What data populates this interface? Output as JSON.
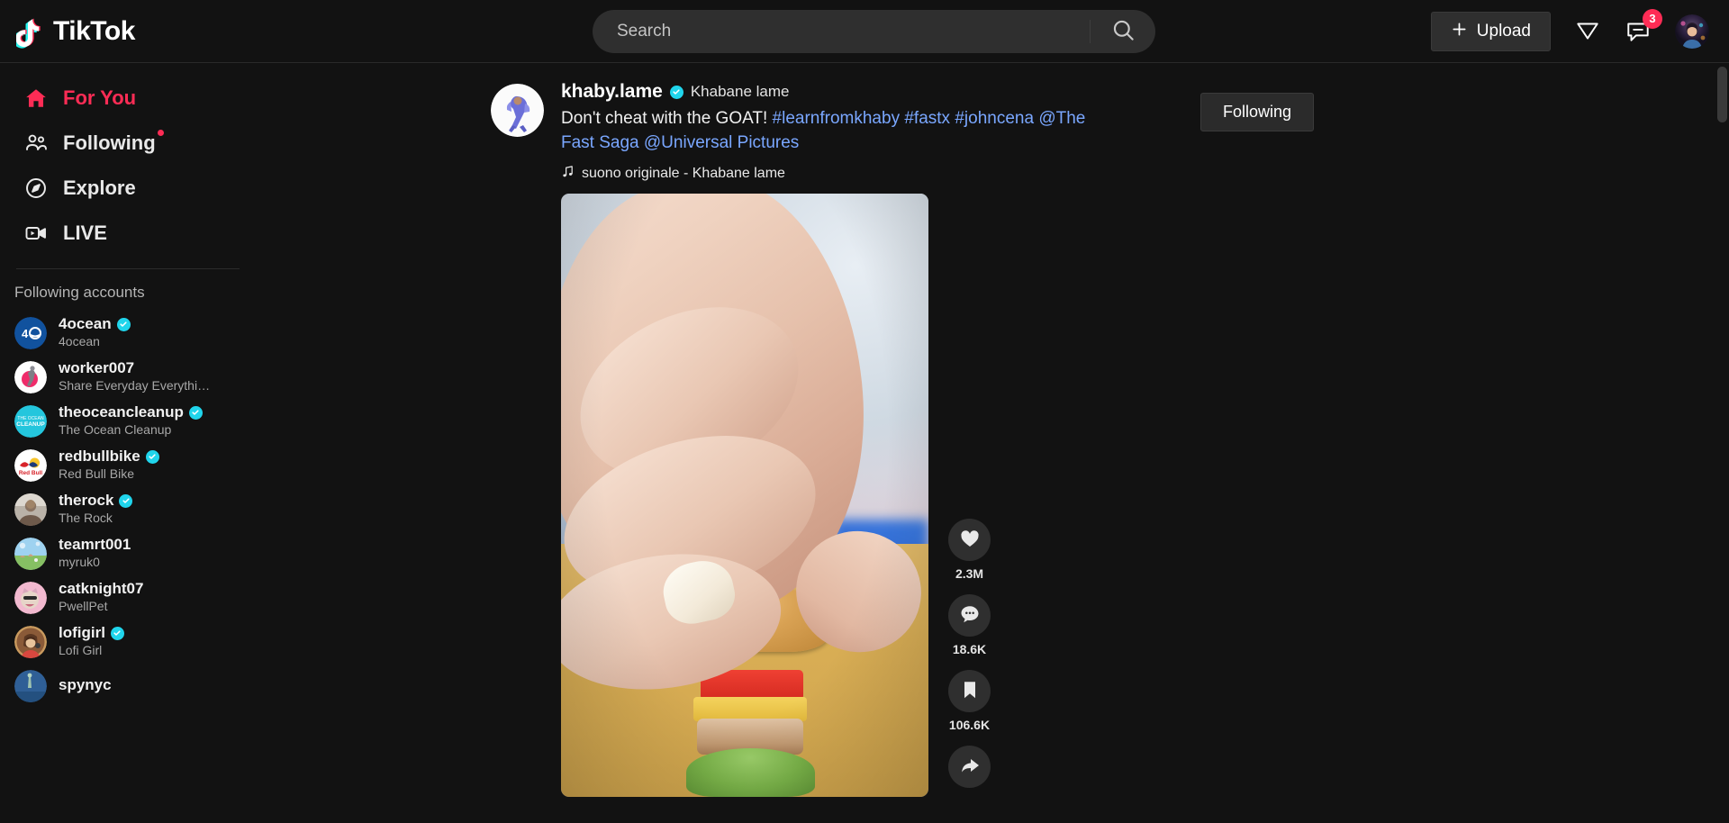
{
  "header": {
    "logo_text": "TikTok",
    "logo_icon": "tiktok-note-icon",
    "search": {
      "placeholder": "Search",
      "value": "",
      "icon": "search-icon"
    },
    "upload_label": "Upload",
    "upload_icon": "plus-icon",
    "send_icon": "paper-plane-icon",
    "messages_icon": "message-icon",
    "messages_badge": "3",
    "profile_icon": "user-avatar"
  },
  "sidebar": {
    "nav": [
      {
        "label": "For You",
        "icon": "home-icon",
        "active": true,
        "dot": false
      },
      {
        "label": "Following",
        "icon": "people-icon",
        "active": false,
        "dot": true
      },
      {
        "label": "Explore",
        "icon": "compass-icon",
        "active": false,
        "dot": false
      },
      {
        "label": "LIVE",
        "icon": "live-video-icon",
        "active": false,
        "dot": false
      }
    ],
    "section_title": "Following accounts",
    "accounts": [
      {
        "name": "4ocean",
        "sub": "4ocean",
        "verified": true,
        "avatar": "4ocean-logo"
      },
      {
        "name": "worker007",
        "sub": "Share Everyday Everythi…",
        "verified": false,
        "avatar": "worker007-logo"
      },
      {
        "name": "theoceancleanup",
        "sub": "The Ocean Cleanup",
        "verified": true,
        "avatar": "oceancleanup-logo"
      },
      {
        "name": "redbullbike",
        "sub": "Red Bull Bike",
        "verified": true,
        "avatar": "redbull-logo"
      },
      {
        "name": "therock",
        "sub": "The Rock",
        "verified": true,
        "avatar": "therock-photo"
      },
      {
        "name": "teamrt001",
        "sub": "myruk0",
        "verified": false,
        "avatar": "teamrt001-photo"
      },
      {
        "name": "catknight07",
        "sub": "PwellPet",
        "verified": false,
        "avatar": "catknight07-photo"
      },
      {
        "name": "lofigirl",
        "sub": "Lofi Girl",
        "verified": true,
        "avatar": "lofigirl-art"
      },
      {
        "name": "spynyc",
        "sub": "",
        "verified": false,
        "avatar": "spynyc-photo"
      }
    ]
  },
  "post": {
    "username": "khaby.lame",
    "verified": true,
    "nickname": "Khabane lame",
    "caption_text": "Don't cheat with the GOAT! ",
    "caption_tags": [
      "#learnfromkhaby",
      "#fastx",
      "#johncena",
      "@The Fast Saga",
      "@Universal Pictures"
    ],
    "music_icon": "music-note-icon",
    "music_label": "suono originale - Khabane lame",
    "follow_label": "Following",
    "actions": [
      {
        "icon": "heart-icon",
        "count": "2.3M",
        "name": "like"
      },
      {
        "icon": "comment-icon",
        "count": "18.6K",
        "name": "comment"
      },
      {
        "icon": "bookmark-icon",
        "count": "106.6K",
        "name": "bookmark"
      },
      {
        "icon": "share-icon",
        "count": "",
        "name": "share"
      }
    ]
  },
  "colors": {
    "accent_red": "#FE2C55",
    "accent_cyan": "#20D5EC",
    "link_blue": "#7AA7FF",
    "bg": "#121212"
  }
}
